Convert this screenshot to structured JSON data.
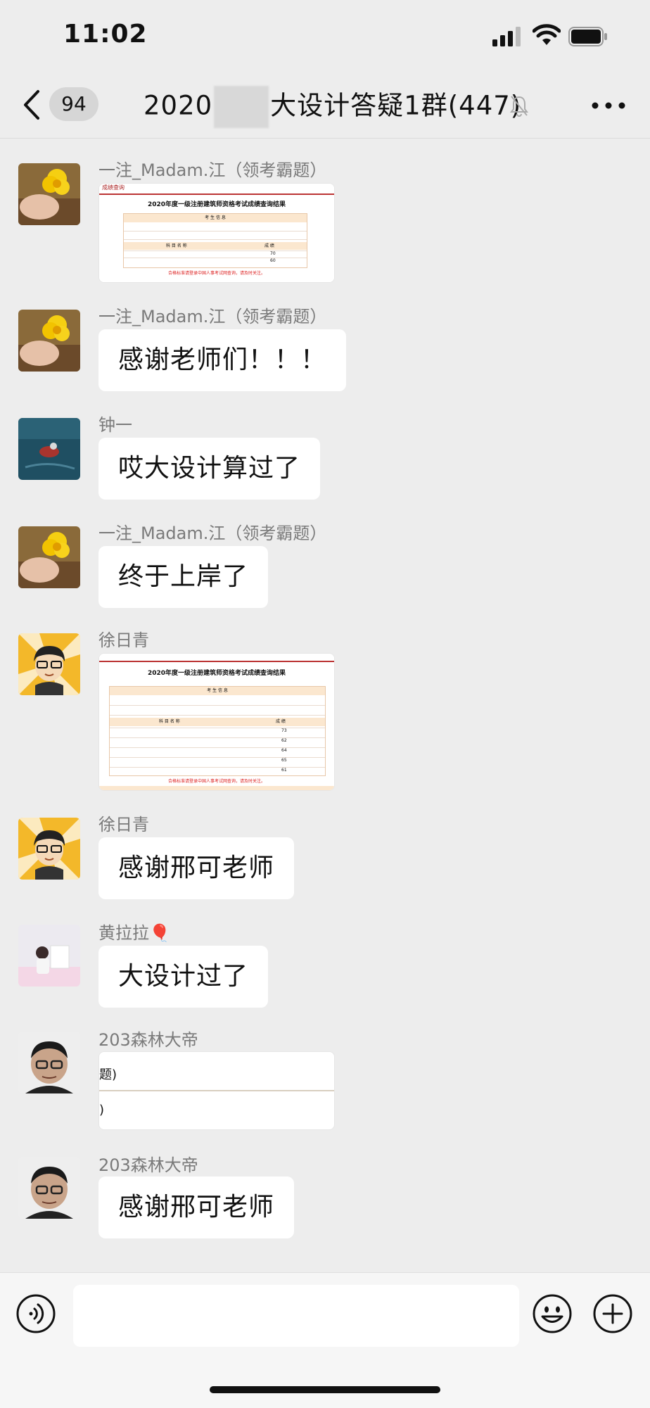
{
  "status_bar": {
    "time": "11:02"
  },
  "header": {
    "back_badge": "94",
    "title_prefix": "2020",
    "title_suffix": "大设计答疑1群(447)"
  },
  "messages": [
    {
      "sender": "一注_Madam.江（领考霸题）",
      "type": "image"
    },
    {
      "sender": "一注_Madam.江（领考霸题）",
      "type": "text",
      "text": "感谢老师们！！！"
    },
    {
      "sender": "钟一",
      "type": "text",
      "text": "哎大设计算过了"
    },
    {
      "sender": "一注_Madam.江（领考霸题）",
      "type": "text",
      "text": "终于上岸了"
    },
    {
      "sender": "徐日青",
      "type": "image"
    },
    {
      "sender": "徐日青",
      "type": "text",
      "text": "感谢邢可老师"
    },
    {
      "sender": "黄拉拉🎈",
      "type": "text",
      "text": "大设计过了"
    },
    {
      "sender": "203森林大帝",
      "type": "image",
      "fragments": [
        "题)",
        ")"
      ]
    },
    {
      "sender": "203森林大帝",
      "type": "text",
      "text": "感谢邢可老师"
    }
  ],
  "doc1": {
    "header": "成绩查询",
    "title": "2020年度一级注册建筑师资格考试成绩查询结果",
    "section": "考 生 信 息",
    "subject_head": "科 目 名 称",
    "score_head": "成 绩",
    "scores": [
      "60",
      "70"
    ],
    "note": "合格标准请登录中国人事考试网查询，请及时关注。"
  },
  "doc2": {
    "title": "2020年度一级注册建筑师资格考试成绩查询结果",
    "section": "考 生 信 息",
    "subject_head": "科 目 名 称",
    "score_head": "成 绩",
    "scores": [
      "73",
      "62",
      "64",
      "65",
      "61"
    ],
    "note": "合格标准请登录中国人事考试网查询，请及时关注。"
  },
  "colors": {
    "bg": "#ededed",
    "bubble": "#ffffff",
    "accent_red": "#b33333"
  }
}
